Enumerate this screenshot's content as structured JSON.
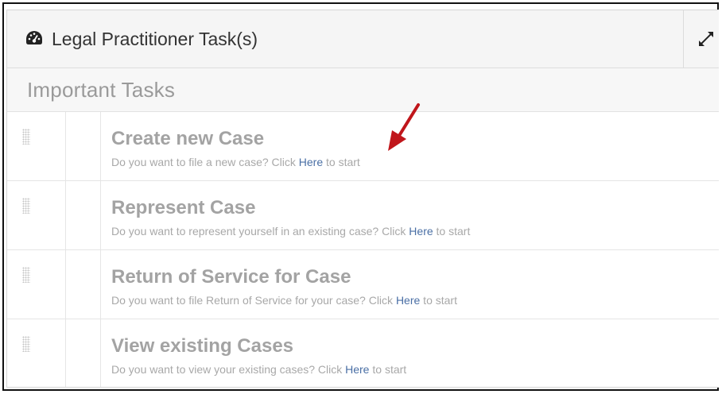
{
  "panel": {
    "title": "Legal Practitioner Task(s)",
    "icon": "dashboard-icon",
    "expand_icon": "expand-icon"
  },
  "section": {
    "title": "Important Tasks"
  },
  "tasks": [
    {
      "title": "Create new Case",
      "desc_prefix": "Do you want to file a new case? Click ",
      "link": "Here",
      "desc_suffix": " to start"
    },
    {
      "title": "Represent Case",
      "desc_prefix": "Do you want to represent yourself in an existing case? Click ",
      "link": "Here",
      "desc_suffix": " to start"
    },
    {
      "title": "Return of Service for Case",
      "desc_prefix": "Do you want to file Return of Service for your case? Click ",
      "link": "Here",
      "desc_suffix": " to start"
    },
    {
      "title": "View existing Cases",
      "desc_prefix": "Do you want to view your existing cases? Click ",
      "link": "Here",
      "desc_suffix": " to start"
    }
  ],
  "colors": {
    "link": "#4a6fa5",
    "annotation_arrow": "#c0161b"
  }
}
